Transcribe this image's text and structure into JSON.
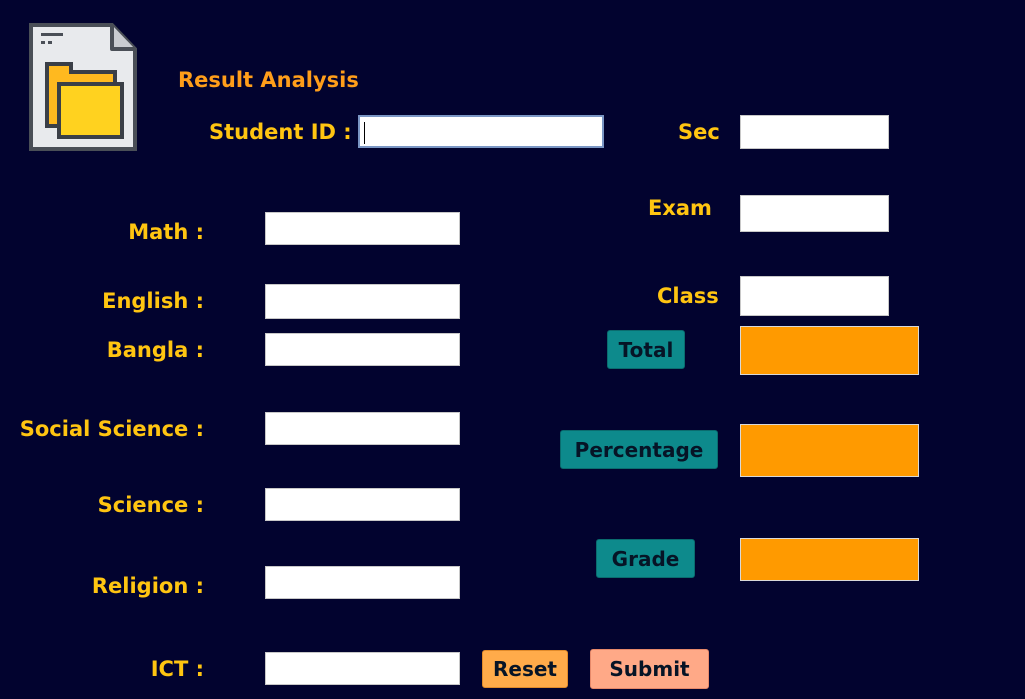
{
  "app": {
    "title": "Result Analysis",
    "icon": "document-folder-icon"
  },
  "colors": {
    "background": "#02032f",
    "label": "#ffc511",
    "title": "#ff9e1a",
    "output_fill": "#ff9a00",
    "teal_button": "#0d8a8c",
    "reset_button": "#ffab4a",
    "submit_button": "#ffa987"
  },
  "header": {
    "student_id_label": "Student ID :",
    "student_id_value": "",
    "sec_label": "Sec",
    "sec_value": "",
    "exam_label": "Exam",
    "exam_value": "",
    "class_label": "Class",
    "class_value": ""
  },
  "subjects": [
    {
      "label": "Math :",
      "value": ""
    },
    {
      "label": "English :",
      "value": ""
    },
    {
      "label": "Bangla :",
      "value": ""
    },
    {
      "label": "Social Science :",
      "value": ""
    },
    {
      "label": "Science :",
      "value": ""
    },
    {
      "label": "Religion :",
      "value": ""
    },
    {
      "label": "ICT :",
      "value": ""
    }
  ],
  "results": {
    "total_label": "Total",
    "total_value": "",
    "percentage_label": "Percentage",
    "percentage_value": "",
    "grade_label": "Grade",
    "grade_value": ""
  },
  "actions": {
    "reset_label": "Reset",
    "submit_label": "Submit"
  }
}
